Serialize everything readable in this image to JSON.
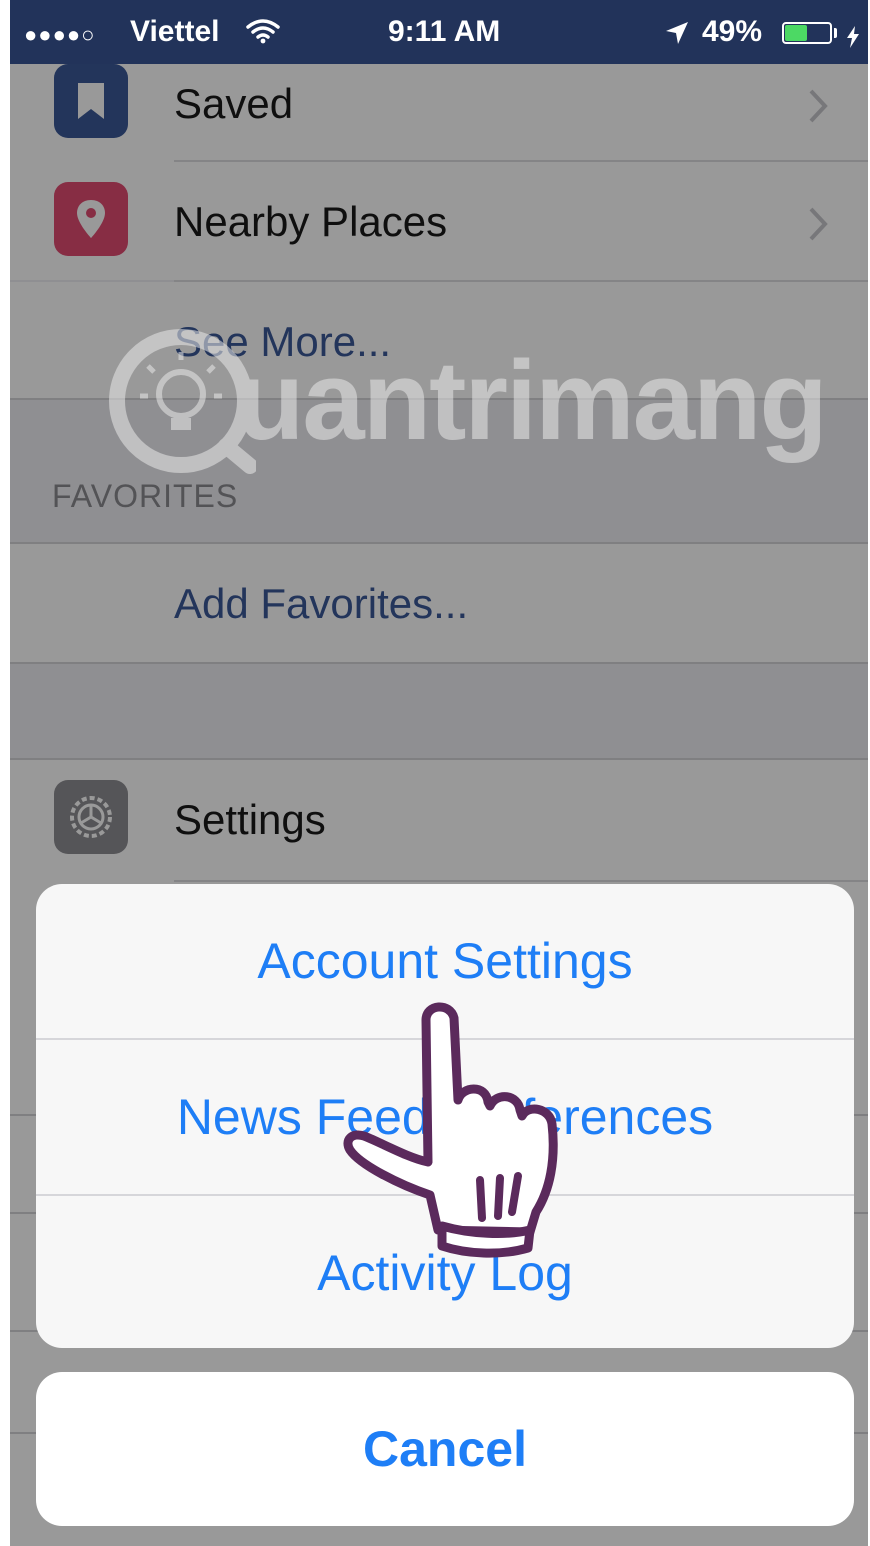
{
  "status_bar": {
    "signal_dots": "●●●●○",
    "carrier": "Viettel",
    "time": "9:11 AM",
    "battery_percent": "49%",
    "battery_level": 0.49,
    "icons": [
      "wifi-icon",
      "location-arrow-icon",
      "battery-icon",
      "charging-bolt-icon"
    ]
  },
  "menu": {
    "items": [
      {
        "label": "Saved",
        "icon": "bookmark-icon",
        "icon_color": "#3b5998"
      },
      {
        "label": "Nearby Places",
        "icon": "map-pin-icon",
        "icon_color": "#e24b72"
      }
    ],
    "see_more": "See More...",
    "favorites_header": "FAVORITES",
    "add_favorites": "Add Favorites...",
    "settings": {
      "label": "Settings",
      "icon": "gear-icon",
      "icon_color": "#8e8e93"
    }
  },
  "action_sheet": {
    "options": [
      "Account Settings",
      "News Feed Preferences",
      "Activity Log"
    ],
    "cancel": "Cancel",
    "accent_color": "#1e7ef6"
  },
  "watermark": {
    "text": "uantrimang",
    "icon": "lightbulb-logo-icon"
  }
}
